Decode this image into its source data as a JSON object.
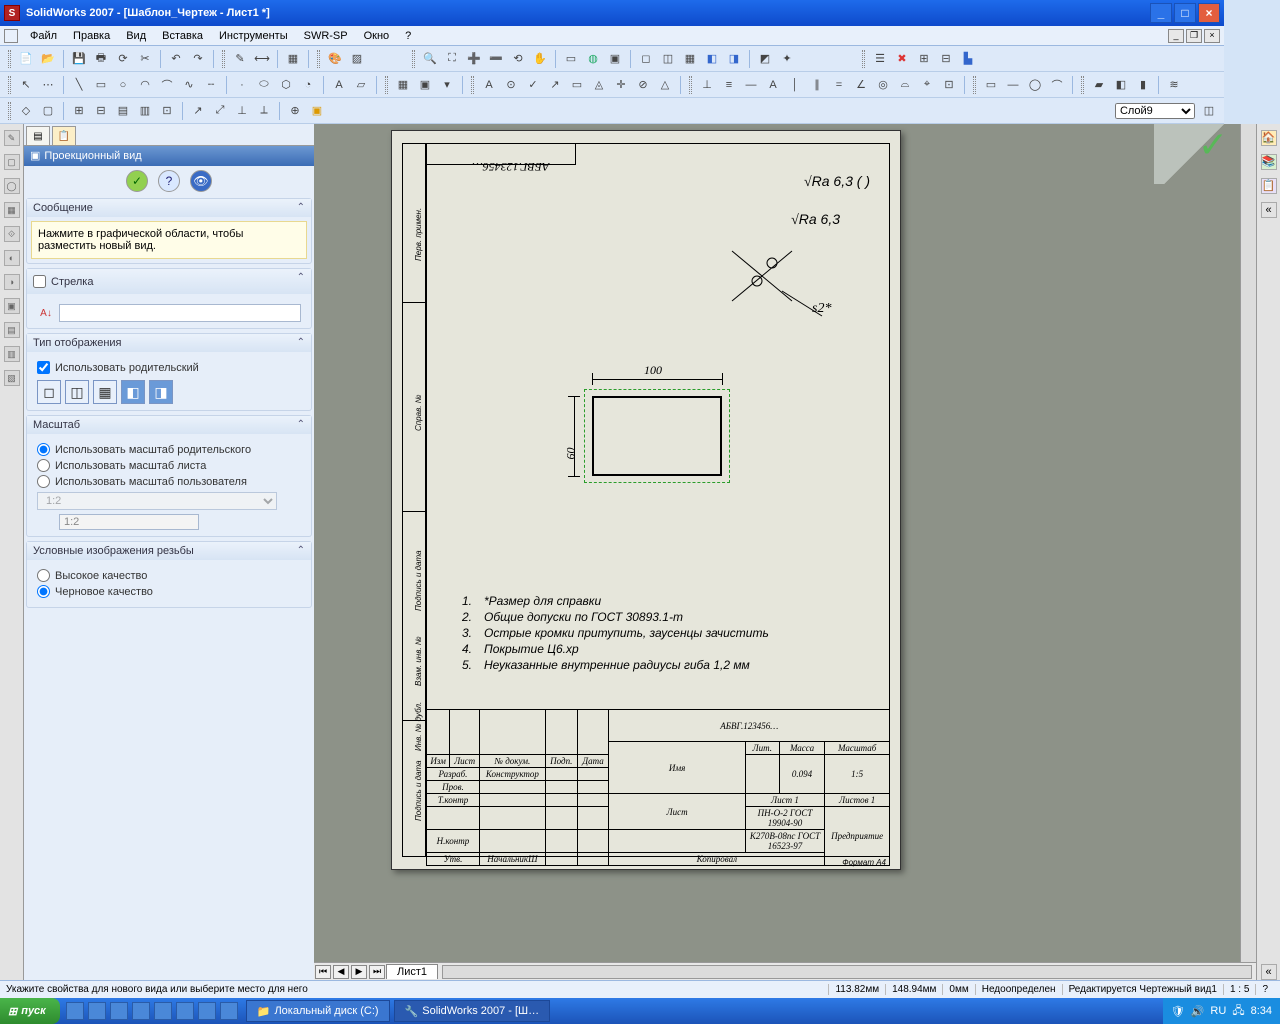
{
  "title": "SolidWorks 2007 - [Шаблон_Чертеж - Лист1 *]",
  "menu": [
    "Файл",
    "Правка",
    "Вид",
    "Вставка",
    "Инструменты",
    "SWR-SP",
    "Окно",
    "?"
  ],
  "layer": "Слой9",
  "panel": {
    "title": "Проекционный вид",
    "msg_hdr": "Сообщение",
    "msg": "Нажмите в графической области, чтобы разместить новый вид.",
    "arrow_hdr": "Стрелка",
    "disp_hdr": "Тип отображения",
    "use_parent": "Использовать родительский",
    "scale_hdr": "Масштаб",
    "scale_opts": [
      "Использовать масштаб родительского",
      "Использовать масштаб листа",
      "Использовать масштаб пользователя"
    ],
    "scale_val": "1:2",
    "thread_hdr": "Условные изображения резьбы",
    "thread_opts": [
      "Высокое качество",
      "Черновое качество"
    ]
  },
  "drawing": {
    "docnum_top": "АБВГ.123456…",
    "ra1": "Ra 6,3 (   )",
    "ra2": "Ra 6,3",
    "s2": "s2*",
    "dim_w": "100",
    "dim_h": "60",
    "notes": [
      "*Размер для справки",
      "Общие допуски по ГОСТ 30893.1-m",
      "Острые кромки притупить, заусенцы зачистить",
      "Покрытие Ц6.хр",
      "Неуказанные внутренние радиусы гиба 1,2 мм"
    ],
    "tb": {
      "doc": "АБВГ.123456…",
      "name": "Имя",
      "company": "Предприятие",
      "mass": "0.094",
      "scale": "1:5",
      "lit": "Лит.",
      "massL": "Масса",
      "scaleL": "Масштаб",
      "list": "Лист 1",
      "listov": "Листов 1",
      "lines": [
        "Разраб.",
        "Пров.",
        "Т.контр",
        "",
        "Н.контр",
        "Утв."
      ],
      "konstr": "Конструктор",
      "nacha": "НачальникШ",
      "mat1": "ПН-О-2 ГОСТ 19904-90",
      "mat2": "К270В-08пс ГОСТ 16523-97",
      "listL": "Лист",
      "format": "Формат A4",
      "kopir": "Копировал",
      "h": [
        "Изм",
        "Лист",
        "№ докум.",
        "Подп.",
        "Дата"
      ]
    }
  },
  "sheet_tab": "Лист1",
  "status": {
    "prompt": "Укажите свойства для нового вида или выберите место для него",
    "x": "113.82мм",
    "y": "148.94мм",
    "z": "0мм",
    "def": "Недоопределен",
    "edit": "Редактируется Чертежный вид1",
    "sc": "1 : 5"
  },
  "taskbar": {
    "start": "пуск",
    "tasks": [
      "Локальный диск (C:)",
      "SolidWorks 2007 - [Ш…"
    ],
    "lang": "RU",
    "time": "8:34"
  }
}
